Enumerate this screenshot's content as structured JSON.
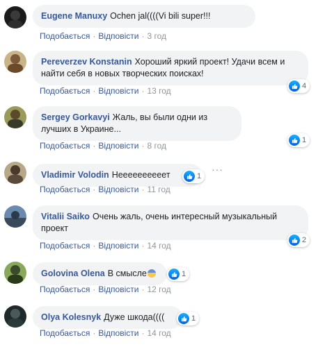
{
  "actions": {
    "like_label": "Подобається",
    "reply_label": "Відповісти",
    "separator": "·"
  },
  "comments": [
    {
      "author": "Eugene Manuxy",
      "text": "Ochen jal((((Vi bili super!!!",
      "time": "3 год",
      "reactions": null,
      "avatar_color": "#222222"
    },
    {
      "author": "Pereverzev Konstanin",
      "text": "Хороший яркий проект! Удачи всем и найти себя в новых творческих поисках!",
      "time": "13 год",
      "reactions": "4",
      "avatar_color": "#8a6b3a"
    },
    {
      "author": "Sergey Gorkavyi",
      "text": "Жаль, вы были одни из лучших в Украине...",
      "time": "8 год",
      "reactions": "1",
      "avatar_color": "#7a7a3a"
    },
    {
      "author": "Vladimir Volodin",
      "text": "Неееееееееет",
      "time": "11 год",
      "reactions": "1",
      "avatar_color": "#6b5a4a"
    },
    {
      "author": "Vitalii Saiko",
      "text": "Очень жаль, очень интересный музыкальный проект",
      "time": "14 год",
      "reactions": "2",
      "avatar_color": "#4a5a7a"
    },
    {
      "author": "Golovina Olena",
      "text": "В смысле",
      "time": "12 год",
      "reactions": "1",
      "avatar_color": "#5a7a3a"
    },
    {
      "author": "Olya Kolesnyk",
      "text": "Дуже шкода((((",
      "time": "14 год",
      "reactions": "1",
      "avatar_color": "#2a3a3a"
    }
  ],
  "icons": {
    "like": "like-icon",
    "more": "more-options-icon",
    "emoji": "fearful-face-emoji"
  },
  "colors": {
    "author": "#385898",
    "bubble": "#f2f3f5",
    "meta": "#90949c",
    "like_gradient_top": "#18afff",
    "like_gradient_bottom": "#0062df"
  }
}
